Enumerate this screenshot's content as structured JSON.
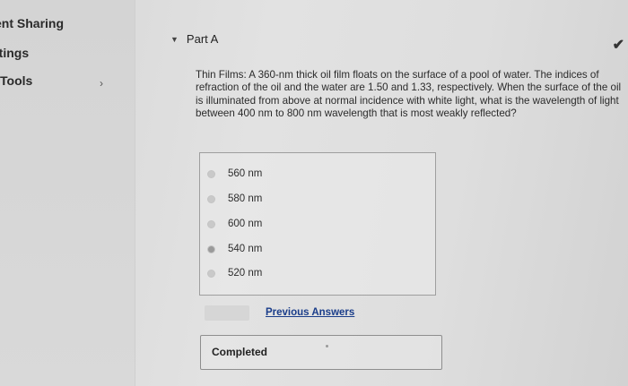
{
  "sidebar": {
    "items": [
      {
        "label": "ent Sharing"
      },
      {
        "label": "ttings"
      },
      {
        "label": "Tools"
      }
    ],
    "chevron": "›"
  },
  "part": {
    "title": "Part A",
    "caret": "▼",
    "check": "✔"
  },
  "question": {
    "text": "Thin Films: A 360-nm thick oil film floats on the surface of a pool of water. The indices of refraction of the oil and the water are 1.50 and 1.33, respectively. When the surface of the oil is illuminated from above at normal incidence with white light, what is the wavelength of light between 400 nm to 800 nm wavelength that is most weakly reflected?"
  },
  "choices": [
    {
      "label": "560 nm",
      "selected": false
    },
    {
      "label": "580 nm",
      "selected": false
    },
    {
      "label": "600 nm",
      "selected": false
    },
    {
      "label": "540 nm",
      "selected": true
    },
    {
      "label": "520 nm",
      "selected": false
    }
  ],
  "actions": {
    "previous_answers": "Previous Answers"
  },
  "status": {
    "completed": "Completed"
  }
}
